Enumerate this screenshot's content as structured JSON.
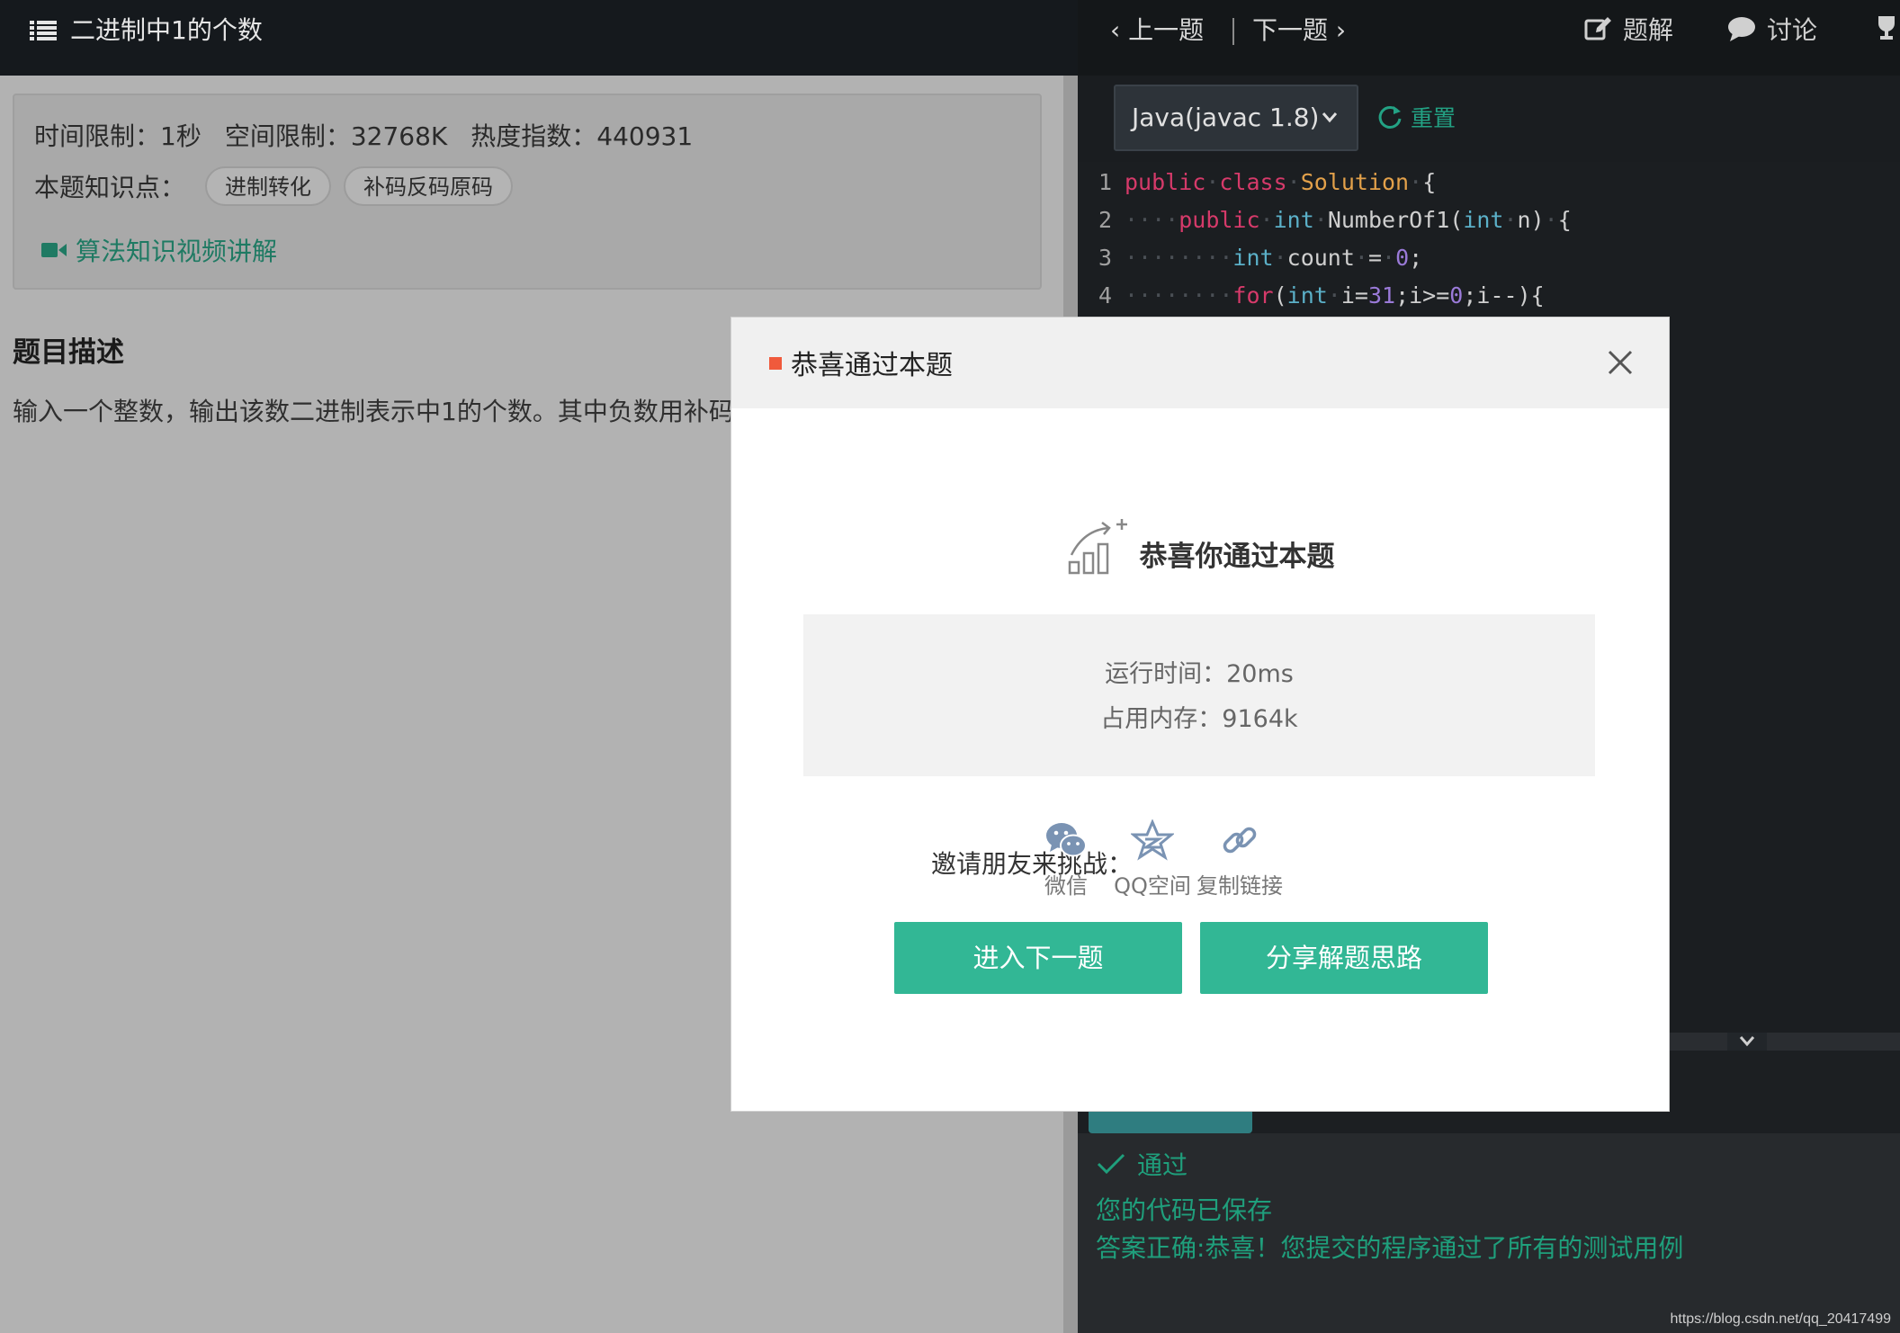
{
  "problem": {
    "title": "二进制中1的个数",
    "time_limit": "时间限制：1秒",
    "space_limit": "空间限制：32768K",
    "heat": "热度指数：440931",
    "knowledge_label": "本题知识点：",
    "tags": [
      "进制转化",
      "补码反码原码"
    ],
    "video_link": "算法知识视频讲解",
    "desc_heading": "题目描述",
    "desc_text": "输入一个整数，输出该数二进制表示中1的个数。其中负数用补码"
  },
  "nav": {
    "prev": "上一题",
    "next": "下一题",
    "solution": "题解",
    "discuss": "讨论"
  },
  "editor": {
    "language": "Java(javac 1.8)",
    "reset": "重置"
  },
  "console": {
    "status": "通过",
    "saved": "您的代码已保存",
    "result": "答案正确:恭喜！您提交的程序通过了所有的测试用例"
  },
  "modal": {
    "title": "恭喜通过本题",
    "headline": "恭喜你通过本题",
    "run_time": "运行时间：20ms",
    "memory": "占用内存：9164k",
    "invite_label": "邀请朋友来挑战：",
    "share": {
      "wechat": "微信",
      "qzone": "QQ空间",
      "copy_link": "复制链接"
    },
    "next_button": "进入下一题",
    "share_button": "分享解题思路"
  },
  "watermark": "https://blog.csdn.net/qq_20417499",
  "colors": {
    "accent_green": "#32b795",
    "modal_bullet": "#f05a3c",
    "console_green": "#1f9f7c"
  }
}
